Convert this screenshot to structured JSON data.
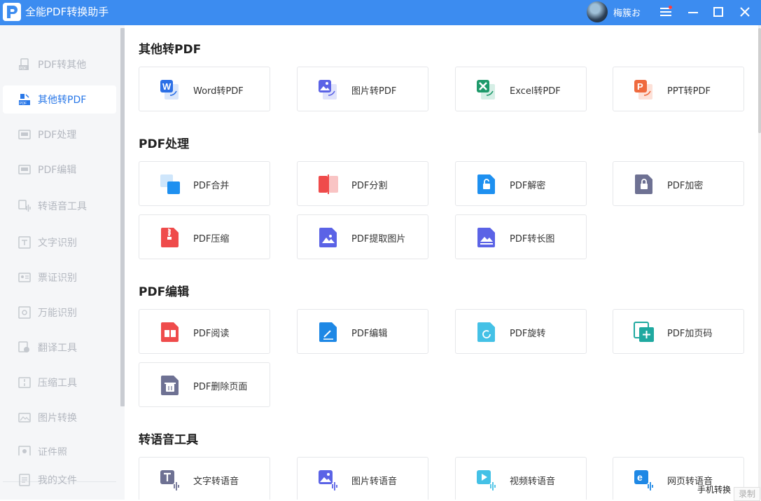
{
  "window": {
    "title": "全能PDF转换助手",
    "username": "梅簇お",
    "brand_color": "#3c8cf0"
  },
  "sidebar": {
    "items": [
      {
        "label": "PDF转其他",
        "icon": "pdf-export-icon",
        "active": false
      },
      {
        "label": "其他转PDF",
        "icon": "pdf-import-icon",
        "active": true
      },
      {
        "label": "PDF处理",
        "icon": "pdf-process-icon",
        "active": false
      },
      {
        "label": "PDF编辑",
        "icon": "pdf-edit-icon",
        "active": false
      },
      {
        "label": "转语音工具",
        "icon": "voice-tool-icon",
        "active": false
      },
      {
        "label": "文字识别",
        "icon": "text-ocr-icon",
        "active": false
      },
      {
        "label": "票证识别",
        "icon": "ticket-ocr-icon",
        "active": false
      },
      {
        "label": "万能识别",
        "icon": "universal-ocr-icon",
        "active": false
      },
      {
        "label": "翻译工具",
        "icon": "translate-icon",
        "active": false
      },
      {
        "label": "压缩工具",
        "icon": "compress-icon",
        "active": false
      },
      {
        "label": "图片转换",
        "icon": "image-convert-icon",
        "active": false
      },
      {
        "label": "证件照",
        "icon": "id-photo-icon",
        "active": false
      }
    ],
    "bottom": {
      "label": "我的文件",
      "icon": "my-files-icon"
    }
  },
  "sections": [
    {
      "title": "其他转PDF",
      "cards": [
        {
          "label": "Word转PDF",
          "icon": "word-to-pdf-icon"
        },
        {
          "label": "图片转PDF",
          "icon": "image-to-pdf-icon"
        },
        {
          "label": "Excel转PDF",
          "icon": "excel-to-pdf-icon"
        },
        {
          "label": "PPT转PDF",
          "icon": "ppt-to-pdf-icon"
        }
      ]
    },
    {
      "title": "PDF处理",
      "cards": [
        {
          "label": "PDF合并",
          "icon": "pdf-merge-icon"
        },
        {
          "label": "PDF分割",
          "icon": "pdf-split-icon"
        },
        {
          "label": "PDF解密",
          "icon": "pdf-decrypt-icon"
        },
        {
          "label": "PDF加密",
          "icon": "pdf-encrypt-icon"
        },
        {
          "label": "PDF压缩",
          "icon": "pdf-compress-icon"
        },
        {
          "label": "PDF提取图片",
          "icon": "pdf-extract-image-icon"
        },
        {
          "label": "PDF转长图",
          "icon": "pdf-long-image-icon"
        }
      ]
    },
    {
      "title": "PDF编辑",
      "cards": [
        {
          "label": "PDF阅读",
          "icon": "pdf-read-icon"
        },
        {
          "label": "PDF编辑",
          "icon": "pdf-edit-doc-icon"
        },
        {
          "label": "PDF旋转",
          "icon": "pdf-rotate-icon"
        },
        {
          "label": "PDF加页码",
          "icon": "pdf-page-number-icon"
        },
        {
          "label": "PDF删除页面",
          "icon": "pdf-delete-page-icon"
        }
      ]
    },
    {
      "title": "转语音工具",
      "cards": [
        {
          "label": "文字转语音",
          "icon": "text-to-speech-icon"
        },
        {
          "label": "图片转语音",
          "icon": "image-to-speech-icon"
        },
        {
          "label": "视频转语音",
          "icon": "video-to-speech-icon"
        },
        {
          "label": "网页转语音",
          "icon": "web-to-speech-icon"
        }
      ]
    }
  ],
  "floating": {
    "phone_convert": "手机转换",
    "record": "录制"
  }
}
